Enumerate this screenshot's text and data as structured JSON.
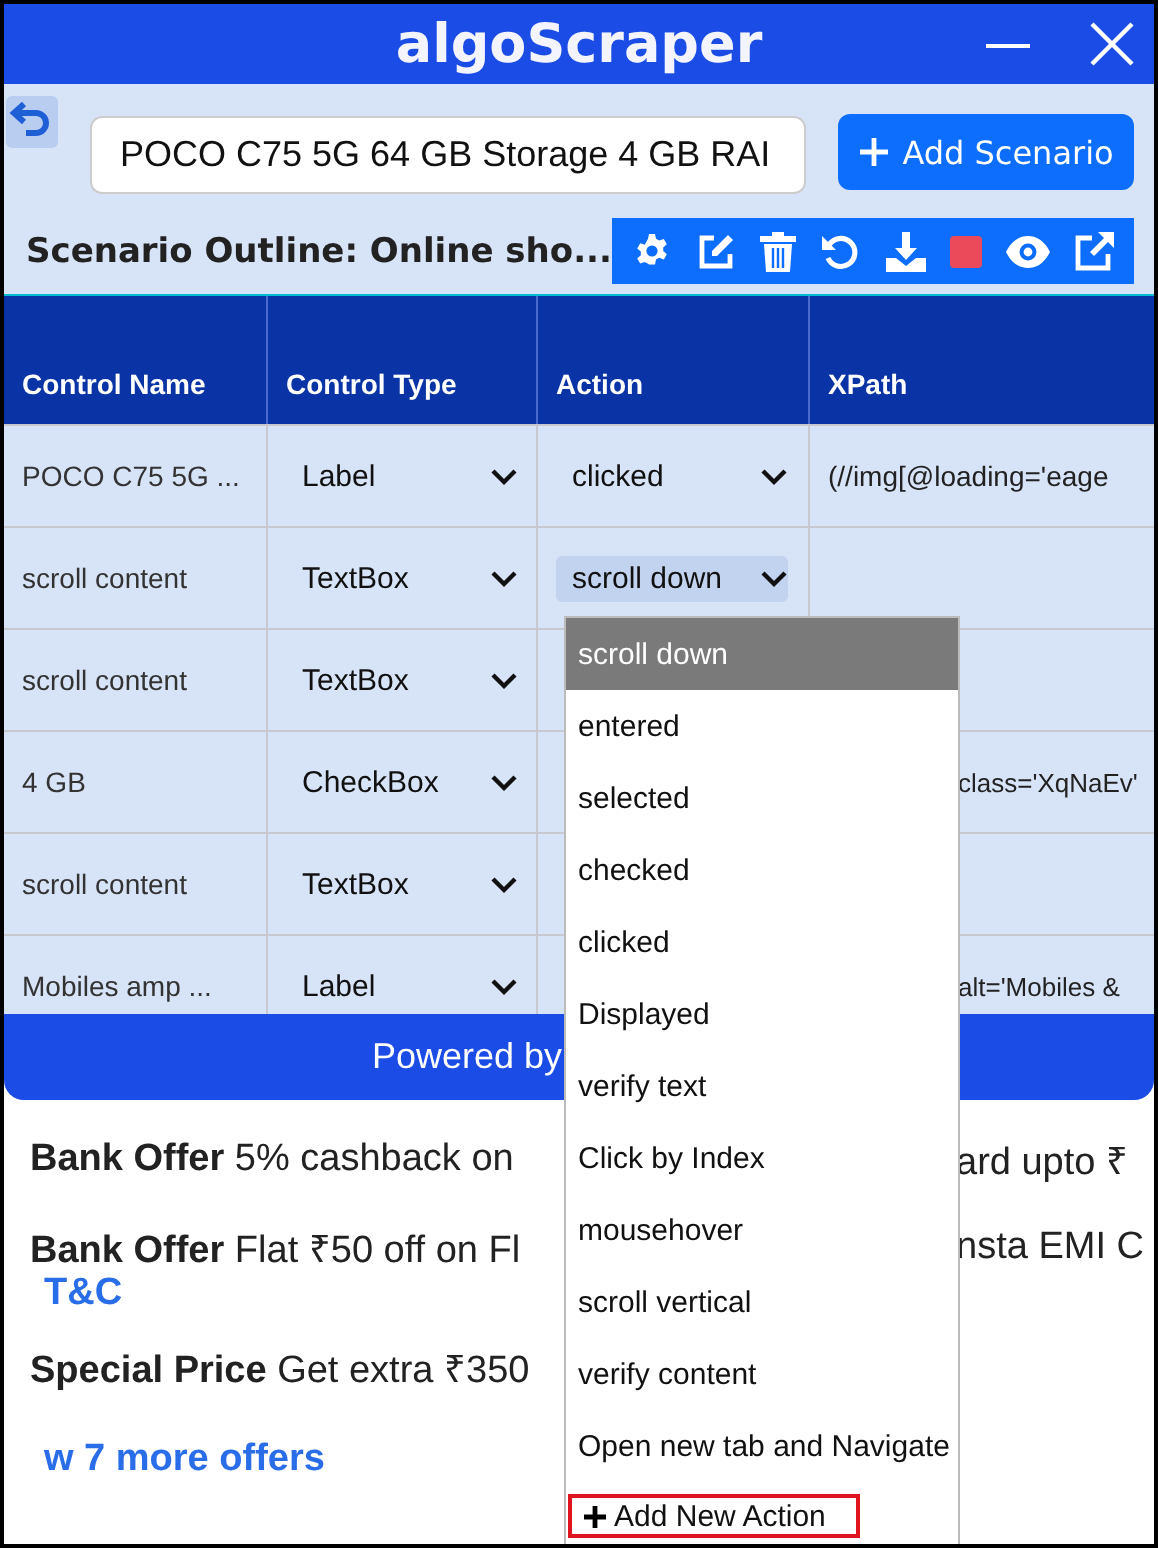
{
  "window": {
    "title": "algoScraper"
  },
  "scenario": {
    "search_value": "POCO C75 5G 64 GB Storage 4 GB RAI",
    "add_button": "Add Scenario",
    "outline_title": "Scenario Outline: Online sho..."
  },
  "table": {
    "columns": [
      "Control Name",
      "Control Type",
      "Action",
      "XPath"
    ],
    "rows": [
      {
        "control_name": "POCO C75 5G ...",
        "control_type": "Label",
        "action": "clicked",
        "xpath": "(//img[@loading='eage"
      },
      {
        "control_name": "scroll content",
        "control_type": "TextBox",
        "action": "scroll down",
        "expanded": true
      },
      {
        "control_name": "scroll content",
        "control_type": "TextBox"
      },
      {
        "control_name": "4 GB",
        "control_type": "CheckBox",
        "xpath": "class='XqNaEv'"
      },
      {
        "control_name": "scroll content",
        "control_type": "TextBox"
      },
      {
        "control_name": "Mobiles amp ...",
        "control_type": "Label",
        "xpath": "alt='Mobiles &"
      }
    ]
  },
  "action_menu": {
    "options": [
      {
        "label": "scroll down",
        "selected": true,
        "kind": "option"
      },
      {
        "label": "entered",
        "selected": false,
        "kind": "option"
      },
      {
        "label": "selected",
        "selected": false,
        "kind": "option"
      },
      {
        "label": "checked",
        "selected": false,
        "kind": "option"
      },
      {
        "label": "clicked",
        "selected": false,
        "kind": "option"
      },
      {
        "label": "Displayed",
        "selected": false,
        "kind": "option"
      },
      {
        "label": "verify text",
        "selected": false,
        "kind": "option"
      },
      {
        "label": "Click by Index",
        "selected": false,
        "kind": "option"
      },
      {
        "label": "mousehover",
        "selected": false,
        "kind": "option"
      },
      {
        "label": "scroll vertical",
        "selected": false,
        "kind": "option"
      },
      {
        "label": "verify content",
        "selected": false,
        "kind": "option"
      },
      {
        "label": "Open new tab and Navigate",
        "selected": false,
        "kind": "option"
      },
      {
        "label": "Add New Action",
        "selected": false,
        "kind": "add"
      }
    ]
  },
  "footer": "Powered by",
  "offers": [
    {
      "kind": "offer",
      "left": "**Bank Offer** 5% cashback on",
      "right": "ard upto ₹"
    },
    {
      "kind": "offer",
      "left": "**Bank Offer** Flat ₹50 off on Fl",
      "right": "nsta EMI C"
    },
    {
      "kind": "link",
      "left": "T&C"
    },
    {
      "kind": "offer",
      "left": "**Special Price** Get extra ₹350"
    },
    {
      "kind": "more",
      "left": "w 7 more offers"
    }
  ]
}
